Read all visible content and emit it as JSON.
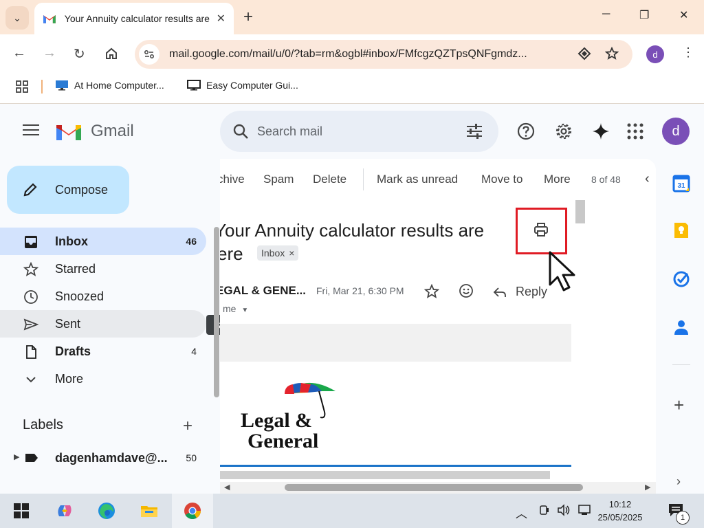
{
  "browser": {
    "tab_title": "Your Annuity calculator results are here",
    "url": "mail.google.com/mail/u/0/?tab=rm&ogbl#inbox/FMfcgzQZTpsQNFgmdz...",
    "profile_initial": "d",
    "bookmarks": [
      {
        "label": "At Home Computer..."
      },
      {
        "label": "Easy Computer Gui..."
      }
    ]
  },
  "gmail": {
    "logo_text": "Gmail",
    "search_placeholder": "Search mail",
    "avatar_initial": "d",
    "compose_label": "Compose",
    "nav": [
      {
        "label": "Inbox",
        "count": "46"
      },
      {
        "label": "Starred",
        "count": ""
      },
      {
        "label": "Snoozed",
        "count": ""
      },
      {
        "label": "Sent",
        "count": ""
      },
      {
        "label": "Drafts",
        "count": "4"
      },
      {
        "label": "More",
        "count": ""
      }
    ],
    "tooltip": "Sent",
    "labels_heading": "Labels",
    "labels": [
      {
        "label": "dagenhamdave@...",
        "count": "50"
      }
    ]
  },
  "message": {
    "actions": [
      "chive",
      "Spam",
      "Delete",
      "Mark as unread",
      "Move to",
      "More"
    ],
    "pager": "8 of 48",
    "subject_line1": "Your Annuity calculator results are",
    "subject_line2": "ere",
    "inbox_chip": "Inbox",
    "chip_close": "×",
    "sender": "EGAL & GENE...",
    "date": "Fri, Mar 21, 6:30 PM",
    "to": "me",
    "reply_label": "Reply",
    "logo_line1": "Legal &",
    "logo_line2": "General"
  },
  "taskbar": {
    "time": "10:12",
    "date": "25/05/2025",
    "notification_count": "1"
  },
  "colors": {
    "accent": "#c2e7ff",
    "active_nav": "#d3e3fd",
    "highlight_box": "#e01b24",
    "avatar": "#7a4fb7"
  }
}
